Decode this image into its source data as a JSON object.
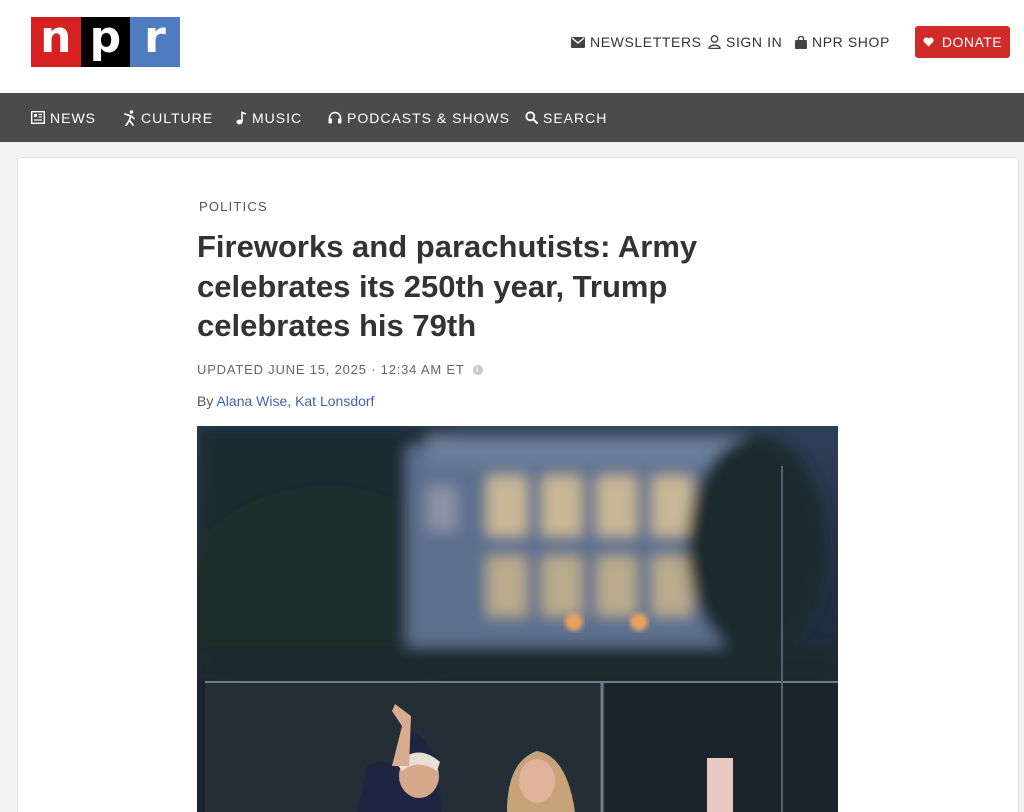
{
  "header": {
    "logo": {
      "letters": [
        "n",
        "p",
        "r"
      ]
    },
    "utility": {
      "newsletters": "NEWSLETTERS",
      "sign_in": "SIGN IN",
      "shop": "NPR SHOP"
    },
    "donate": "DONATE"
  },
  "nav": {
    "items": [
      {
        "label": "NEWS",
        "icon": "news-icon"
      },
      {
        "label": "CULTURE",
        "icon": "culture-icon"
      },
      {
        "label": "MUSIC",
        "icon": "music-icon"
      },
      {
        "label": "PODCASTS & SHOWS",
        "icon": "headphones-icon"
      },
      {
        "label": "SEARCH",
        "icon": "search-icon"
      }
    ]
  },
  "article": {
    "section": "POLITICS",
    "headline": "Fireworks and parachutists: Army celebrates its 250th year, Trump celebrates his 79th",
    "updated": "UPDATED JUNE 15, 2025 · 12:34 AM ET",
    "byline_prefix": "By",
    "authors": [
      "Alana Wise",
      "Kat Lonsdorf"
    ],
    "author_separator": ", "
  },
  "colors": {
    "logo_n": "#d62021",
    "logo_p": "#000000",
    "logo_r": "#4f7cc1",
    "donate": "#cf2c29",
    "nav_bg": "#4b4b4b",
    "link": "#3a66b0"
  }
}
